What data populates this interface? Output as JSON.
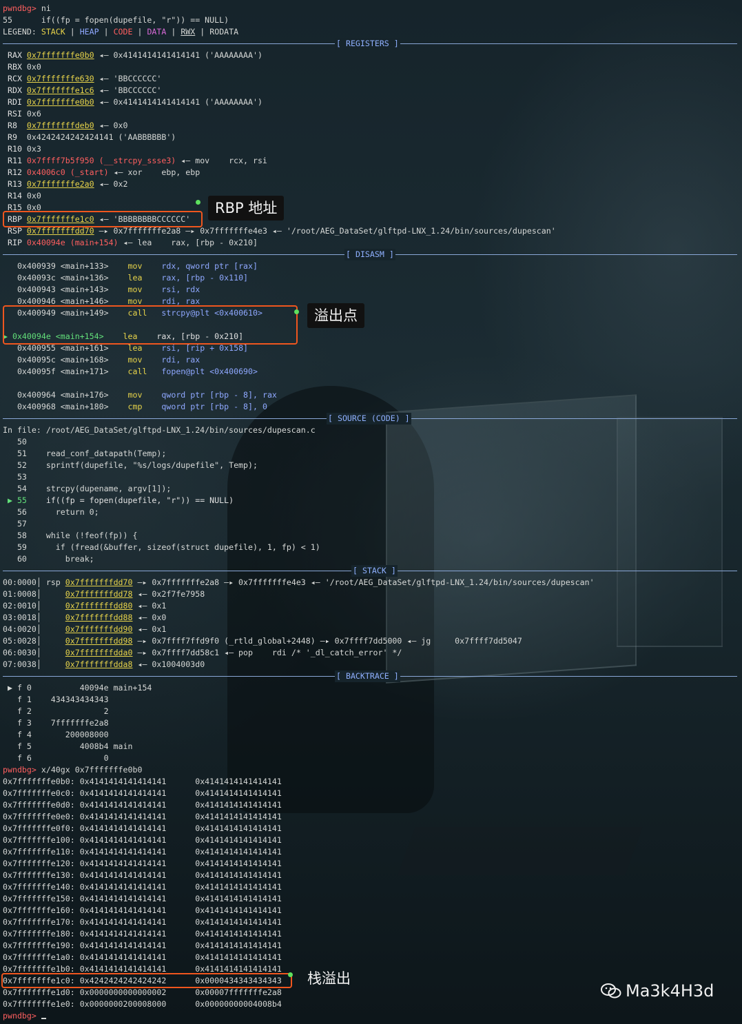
{
  "terminal": {
    "prompt": "pwndbg>",
    "cmd_ni": " ni",
    "line_55_num": "55",
    "line_55_code": "      if((fp = fopen(dupefile, \"r\")) == NULL)",
    "legend": {
      "label": "LEGEND: ",
      "stack": "STACK",
      "heap": "HEAP",
      "code": "CODE",
      "data": "DATA",
      "rwx": "RWX",
      "rodata": "RODATA",
      "sep": " | "
    },
    "sections": {
      "registers": "[ REGISTERS ]",
      "disasm": "[ DISASM ]",
      "source": "[ SOURCE (CODE) ]",
      "stack": "[ STACK ]",
      "backtrace": "[ BACKTRACE ]"
    },
    "registers": [
      {
        "name": "RAX",
        "a": "0x7fffffffe0b0",
        "rest": " ◂— 0x4141414141414141 ('AAAAAAAA')"
      },
      {
        "name": "RBX",
        "a": "",
        "rest": "0x0"
      },
      {
        "name": "RCX",
        "a": "0x7fffffffe630",
        "rest": " ◂— 'BBCCCCCC'"
      },
      {
        "name": "RDX",
        "a": "0x7fffffffe1c6",
        "rest": " ◂— 'BBCCCCCC'"
      },
      {
        "name": "RDI",
        "a": "0x7fffffffe0b0",
        "rest": " ◂— 0x4141414141414141 ('AAAAAAAA')"
      },
      {
        "name": "RSI",
        "a": "",
        "rest": "0x6"
      },
      {
        "name": "R8",
        "a": "0x7fffffffdeb0",
        "rest": " ◂— 0x0"
      },
      {
        "name": "R9",
        "a": "",
        "rest": "0x4242424242424141 ('AABBBBBB')"
      },
      {
        "name": "R10",
        "a": "",
        "rest": "0x3"
      },
      {
        "name": "R11",
        "code": "0x7ffff7b5f950 (__strcpy_ssse3)",
        "rest": " ◂— mov    rcx, rsi"
      },
      {
        "name": "R12",
        "code": "0x4006c0 (_start)",
        "rest": " ◂— xor    ebp, ebp"
      },
      {
        "name": "R13",
        "a": "0x7fffffffe2a0",
        "rest": " ◂— 0x2"
      },
      {
        "name": "R14",
        "a": "",
        "rest": "0x0"
      },
      {
        "name": "R15",
        "a": "",
        "rest": "0x0"
      },
      {
        "name": "RBP",
        "a": "0x7fffffffe1c0",
        "rest": " ◂— 'BBBBBBBBCCCCCC'"
      },
      {
        "name": "RSP",
        "a": "0x7fffffffdd70",
        "rest": " —▸ 0x7fffffffe2a8 —▸ 0x7fffffffe4e3 ◂— '/root/AEG_DataSet/glftpd-LNX_1.24/bin/sources/dupescan'"
      },
      {
        "name": "RIP",
        "code": "0x40094e (main+154)",
        "rest": " ◂— lea    rax, [rbp - 0x210]"
      }
    ],
    "disasm": [
      {
        "addr": "0x400939",
        "sym": "<main+133>",
        "op": "mov",
        "args": "rdx, qword ptr [rax]"
      },
      {
        "addr": "0x40093c",
        "sym": "<main+136>",
        "op": "lea",
        "args": "rax, [rbp - 0x110]"
      },
      {
        "addr": "0x400943",
        "sym": "<main+143>",
        "op": "mov",
        "args": "rsi, rdx"
      },
      {
        "addr": "0x400946",
        "sym": "<main+146>",
        "op": "mov",
        "args": "rdi, rax"
      },
      {
        "addr": "0x400949",
        "sym": "<main+149>",
        "op": "call",
        "args": "strcpy@plt <0x400610>"
      },
      {
        "addr": "",
        "sym": "",
        "op": "",
        "args": ""
      },
      {
        "addr": "0x40094e",
        "sym": "<main+154>",
        "op": "lea",
        "args": "rax, [rbp - 0x210]",
        "current": true
      },
      {
        "addr": "0x400955",
        "sym": "<main+161>",
        "op": "lea",
        "args": "rsi, [rip + 0x158]"
      },
      {
        "addr": "0x40095c",
        "sym": "<main+168>",
        "op": "mov",
        "args": "rdi, rax"
      },
      {
        "addr": "0x40095f",
        "sym": "<main+171>",
        "op": "call",
        "args": "fopen@plt <0x400690>"
      },
      {
        "addr": "",
        "sym": "",
        "op": "",
        "args": ""
      },
      {
        "addr": "0x400964",
        "sym": "<main+176>",
        "op": "mov",
        "args": "qword ptr [rbp - 8], rax"
      },
      {
        "addr": "0x400968",
        "sym": "<main+180>",
        "op": "cmp",
        "args": "qword ptr [rbp - 8], 0"
      }
    ],
    "source_file": "In file: /root/AEG_DataSet/glftpd-LNX_1.24/bin/sources/dupescan.c",
    "source": [
      {
        "n": "50",
        "code": ""
      },
      {
        "n": "51",
        "code": "  read_conf_datapath(Temp);"
      },
      {
        "n": "52",
        "code": "  sprintf(dupefile, \"%s/logs/dupefile\", Temp);"
      },
      {
        "n": "53",
        "code": ""
      },
      {
        "n": "54",
        "code": "  strcpy(dupename, argv[1]);"
      },
      {
        "n": "55",
        "code": "  if((fp = fopen(dupefile, \"r\")) == NULL)",
        "current": true
      },
      {
        "n": "56",
        "code": "    return 0;"
      },
      {
        "n": "57",
        "code": ""
      },
      {
        "n": "58",
        "code": "  while (!feof(fp)) {"
      },
      {
        "n": "59",
        "code": "    if (fread(&buffer, sizeof(struct dupefile), 1, fp) < 1)"
      },
      {
        "n": "60",
        "code": "      break;"
      }
    ],
    "stack": [
      {
        "off": "00:0000",
        "tag": "rsp",
        "addr": "0x7fffffffdd70",
        "rest": " —▸ 0x7fffffffe2a8 —▸ 0x7fffffffe4e3 ◂— '/root/AEG_DataSet/glftpd-LNX_1.24/bin/sources/dupescan'"
      },
      {
        "off": "01:0008",
        "tag": "",
        "addr": "0x7fffffffdd78",
        "rest": " ◂— 0x2f7fe7958"
      },
      {
        "off": "02:0010",
        "tag": "",
        "addr": "0x7fffffffdd80",
        "rest": " ◂— 0x1"
      },
      {
        "off": "03:0018",
        "tag": "",
        "addr": "0x7fffffffdd88",
        "rest": " ◂— 0x0"
      },
      {
        "off": "04:0020",
        "tag": "",
        "addr": "0x7fffffffdd90",
        "rest": " ◂— 0x1"
      },
      {
        "off": "05:0028",
        "tag": "",
        "addr": "0x7fffffffdd98",
        "rest": " —▸ 0x7ffff7ffd9f0 (_rtld_global+2448) —▸ 0x7ffff7dd5000 ◂— jg     0x7ffff7dd5047"
      },
      {
        "off": "06:0030",
        "tag": "",
        "addr": "0x7fffffffdda0",
        "rest": " —▸ 0x7ffff7dd58c1 ◂— pop    rdi /* '_dl_catch_error' */"
      },
      {
        "off": "07:0038",
        "tag": "",
        "addr": "0x7fffffffdda8",
        "rest": " ◂— 0x1004003d0"
      }
    ],
    "backtrace": [
      {
        "f": "▶ f 0",
        "addr": "          40094e",
        "sym": " main+154"
      },
      {
        "f": "  f 1",
        "addr": "    434343434343",
        "sym": ""
      },
      {
        "f": "  f 2",
        "addr": "               2",
        "sym": ""
      },
      {
        "f": "  f 3",
        "addr": "    7fffffffe2a8",
        "sym": ""
      },
      {
        "f": "  f 4",
        "addr": "       200008000",
        "sym": ""
      },
      {
        "f": "  f 5",
        "addr": "          4008b4",
        "sym": " main"
      },
      {
        "f": "  f 6",
        "addr": "               0",
        "sym": ""
      }
    ],
    "cmd_x": " x/40gx 0x7fffffffe0b0",
    "memdump": [
      {
        "a": "0x7fffffffe0b0:",
        "v1": "0x4141414141414141",
        "v2": "0x4141414141414141"
      },
      {
        "a": "0x7fffffffe0c0:",
        "v1": "0x4141414141414141",
        "v2": "0x4141414141414141"
      },
      {
        "a": "0x7fffffffe0d0:",
        "v1": "0x4141414141414141",
        "v2": "0x4141414141414141"
      },
      {
        "a": "0x7fffffffe0e0:",
        "v1": "0x4141414141414141",
        "v2": "0x4141414141414141"
      },
      {
        "a": "0x7fffffffe0f0:",
        "v1": "0x4141414141414141",
        "v2": "0x4141414141414141"
      },
      {
        "a": "0x7fffffffe100:",
        "v1": "0x4141414141414141",
        "v2": "0x4141414141414141"
      },
      {
        "a": "0x7fffffffe110:",
        "v1": "0x4141414141414141",
        "v2": "0x4141414141414141"
      },
      {
        "a": "0x7fffffffe120:",
        "v1": "0x4141414141414141",
        "v2": "0x4141414141414141"
      },
      {
        "a": "0x7fffffffe130:",
        "v1": "0x4141414141414141",
        "v2": "0x4141414141414141"
      },
      {
        "a": "0x7fffffffe140:",
        "v1": "0x4141414141414141",
        "v2": "0x4141414141414141"
      },
      {
        "a": "0x7fffffffe150:",
        "v1": "0x4141414141414141",
        "v2": "0x4141414141414141"
      },
      {
        "a": "0x7fffffffe160:",
        "v1": "0x4141414141414141",
        "v2": "0x4141414141414141"
      },
      {
        "a": "0x7fffffffe170:",
        "v1": "0x4141414141414141",
        "v2": "0x4141414141414141"
      },
      {
        "a": "0x7fffffffe180:",
        "v1": "0x4141414141414141",
        "v2": "0x4141414141414141"
      },
      {
        "a": "0x7fffffffe190:",
        "v1": "0x4141414141414141",
        "v2": "0x4141414141414141"
      },
      {
        "a": "0x7fffffffe1a0:",
        "v1": "0x4141414141414141",
        "v2": "0x4141414141414141"
      },
      {
        "a": "0x7fffffffe1b0:",
        "v1": "0x4141414141414141",
        "v2": "0x4141414141414141"
      },
      {
        "a": "0x7fffffffe1c0:",
        "v1": "0x4242424242424242",
        "v2": "0x0000434343434343"
      },
      {
        "a": "0x7fffffffe1d0:",
        "v1": "0x0000000000000002",
        "v2": "0x00007fffffffe2a8"
      },
      {
        "a": "0x7fffffffe1e0:",
        "v1": "0x0000000200008000",
        "v2": "0x00000000004008b4"
      }
    ]
  },
  "annotations": {
    "rbp_label": "RBP 地址",
    "overflow_point": "溢出点",
    "stack_overflow": "栈溢出"
  },
  "watermark": "Ma3k4H3d",
  "colors": {
    "prompt_red": "#ff5f5f",
    "code_red": "#ff5f5f",
    "stack_yellow": "#e8d44a",
    "heap_blue": "#8fa8ff",
    "data_magenta": "#d86ad8",
    "rule_blue": "#8aa8d8",
    "current_green": "#63e07a",
    "box_orange": "#f0561e"
  }
}
